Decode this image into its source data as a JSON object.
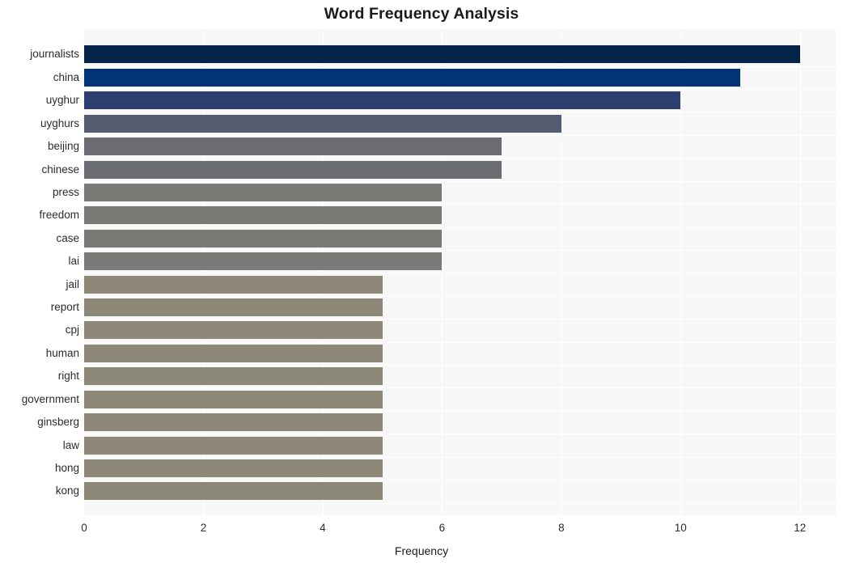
{
  "chart_data": {
    "type": "bar",
    "orientation": "horizontal",
    "title": "Word Frequency Analysis",
    "xlabel": "Frequency",
    "ylabel": "",
    "xlim": [
      0,
      12.6
    ],
    "xticks": [
      0,
      2,
      4,
      6,
      8,
      10,
      12
    ],
    "xticklabels": [
      "0",
      "2",
      "4",
      "6",
      "8",
      "10",
      "12"
    ],
    "grid": true,
    "legend": null,
    "categories": [
      "journalists",
      "china",
      "uyghur",
      "uyghurs",
      "beijing",
      "chinese",
      "press",
      "freedom",
      "case",
      "lai",
      "jail",
      "report",
      "cpj",
      "human",
      "right",
      "government",
      "ginsberg",
      "law",
      "hong",
      "kong"
    ],
    "values": [
      12,
      11,
      10,
      8,
      7,
      7,
      6,
      6,
      6,
      6,
      5,
      5,
      5,
      5,
      5,
      5,
      5,
      5,
      5,
      5
    ],
    "bar_colors": [
      "#042349",
      "#003377",
      "#2d3f6e",
      "#565c70",
      "#6b6b72",
      "#6b6b72",
      "#7b7a76",
      "#7b7a76",
      "#7b7a76",
      "#7b7a76",
      "#8d8878",
      "#8d8878",
      "#8d8878",
      "#8d8878",
      "#8d8878",
      "#8d8878",
      "#8d8878",
      "#8d8878",
      "#8d8878",
      "#8d8878"
    ],
    "plot_background": "#f7f7f7",
    "figure_background": "#ffffff",
    "gridline_color": "#ffffff"
  }
}
